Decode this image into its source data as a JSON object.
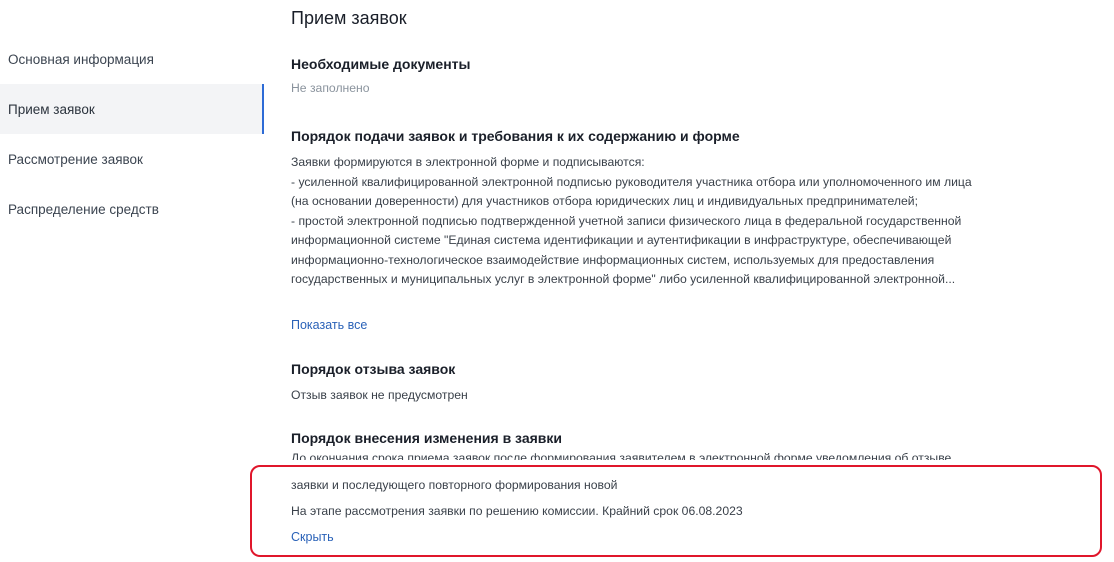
{
  "sidebar": {
    "items": [
      {
        "label": "Основная информация",
        "active": false
      },
      {
        "label": "Прием заявок",
        "active": true
      },
      {
        "label": "Рассмотрение заявок",
        "active": false
      },
      {
        "label": "Распределение средств",
        "active": false
      }
    ]
  },
  "main": {
    "title": "Прием заявок",
    "required_docs": {
      "title": "Необходимые документы",
      "value": "Не заполнено"
    },
    "submission": {
      "title": "Порядок подачи заявок и требования к их содержанию и форме",
      "lines": [
        "Заявки формируются в электронной форме и подписываются:",
        "- усиленной квалифицированной электронной подписью руководителя участника отбора или уполномоченного им лица",
        "(на основании доверенности) для участников отбора юридических лиц и индивидуальных предпринимателей;",
        "- простой электронной подписью подтвержденной учетной записи физического лица в федеральной государственной",
        "информационной системе \"Единая система идентификации и аутентификации в инфраструктуре, обеспечивающей",
        "информационно-технологическое взаимодействие информационных систем, используемых для предоставления",
        "государственных и муниципальных услуг в электронной форме\" либо усиленной квалифицированной электронной..."
      ],
      "show_all_label": "Показать все"
    },
    "withdrawal": {
      "title": "Порядок отзыва заявок",
      "value": "Отзыв заявок не предусмотрен"
    },
    "changes": {
      "title": "Порядок внесения изменения в заявки",
      "cut_line": "До окончания срока приема заявок после формирования заявителем в электронной форме уведомления об отзыве",
      "line2": "заявки и последующего повторного формирования новой",
      "line3": "На этапе рассмотрения заявки по решению комиссии. Крайний срок 06.08.2023",
      "hide_label": "Скрыть"
    }
  },
  "colors": {
    "accent": "#2d6bd6",
    "link": "#2a62b8",
    "highlight_border": "#e0162b"
  }
}
